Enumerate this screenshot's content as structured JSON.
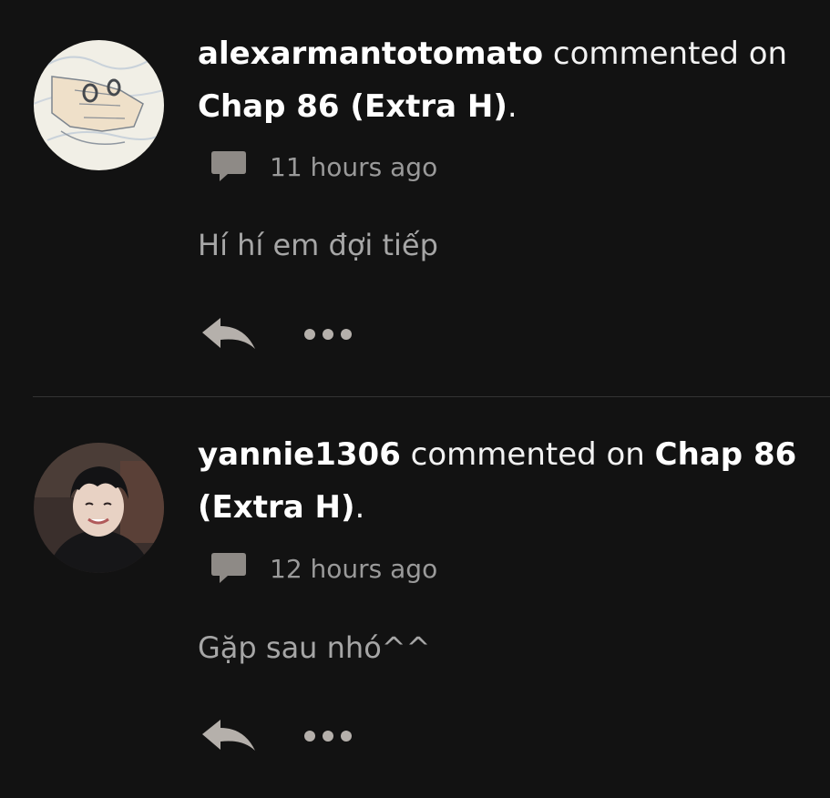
{
  "comments": [
    {
      "username": "alexarmantotomato",
      "action_text": " commented on ",
      "target": "Chap 86 (Extra H)",
      "end_punct": ".",
      "time": "11 hours ago",
      "text": "Hí hí em đợi tiếp",
      "reply_icon": "reply-arrow-icon",
      "more_icon": "more-dots-icon"
    },
    {
      "username": "yannie1306",
      "action_text": " commented on ",
      "target": "Chap 86 (Extra H)",
      "end_punct": ".",
      "time": "12 hours ago",
      "text": "Gặp sau nhó^^",
      "reply_icon": "reply-arrow-icon",
      "more_icon": "more-dots-icon"
    }
  ],
  "colors": {
    "background": "#121212",
    "username": "#ffffff",
    "meta_text": "#9a9a9a",
    "comment_text": "#a6a6a6",
    "icon": "#b5b0ab",
    "divider": "#333333"
  }
}
